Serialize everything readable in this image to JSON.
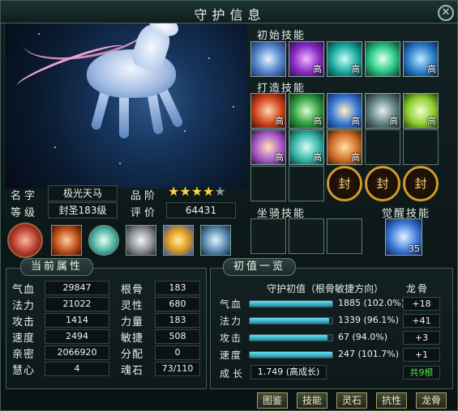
{
  "window": {
    "title": "守护信息"
  },
  "sections": {
    "initial_skills": "初始技能",
    "forged_skills": "打造技能",
    "mount_skills": "坐骑技能",
    "awaken_skills": "觉醒技能"
  },
  "badges": {
    "high": "高",
    "seal": "封",
    "awaken_level": "35"
  },
  "info": {
    "name_label": "名字",
    "name_value": "极光天马",
    "grade_label": "品阶",
    "stars_filled": 4,
    "stars_total": 5,
    "level_label": "等级",
    "level_value": "封圣183级",
    "rating_label": "评价",
    "rating_value": "64431"
  },
  "attributes": {
    "title": "当前属性",
    "rows": [
      {
        "l1": "气血",
        "v1": "29847",
        "l2": "根骨",
        "v2": "183"
      },
      {
        "l1": "法力",
        "v1": "21022",
        "l2": "灵性",
        "v2": "680"
      },
      {
        "l1": "攻击",
        "v1": "1414",
        "l2": "力量",
        "v2": "183"
      },
      {
        "l1": "速度",
        "v1": "2494",
        "l2": "敏捷",
        "v2": "508"
      },
      {
        "l1": "亲密",
        "v1": "2066920",
        "l2": "分配",
        "v2": "0"
      },
      {
        "l1": "慧心",
        "v1": "4",
        "l2": "魂石",
        "v2": "73/110"
      }
    ]
  },
  "initial_values": {
    "title": "初值一览",
    "header": "守护初值（根骨敏捷方向）",
    "dragon_header": "龙骨",
    "rows": [
      {
        "label": "气血",
        "value": "1885 (102.0%)",
        "fill": 1.0,
        "dragon": "+18"
      },
      {
        "label": "法力",
        "value": "1339 (96.1%)",
        "fill": 0.96,
        "dragon": "+41"
      },
      {
        "label": "攻击",
        "value": "67 (94.0%)",
        "fill": 0.94,
        "dragon": "+3"
      },
      {
        "label": "速度",
        "value": "247 (101.7%)",
        "fill": 1.0,
        "dragon": "+1"
      }
    ],
    "growth_label": "成长",
    "growth_value": "1.749 (高成长)",
    "dragon_total": "共9根"
  },
  "buttons": [
    "图鉴",
    "技能",
    "灵石",
    "抗性",
    "龙骨"
  ]
}
